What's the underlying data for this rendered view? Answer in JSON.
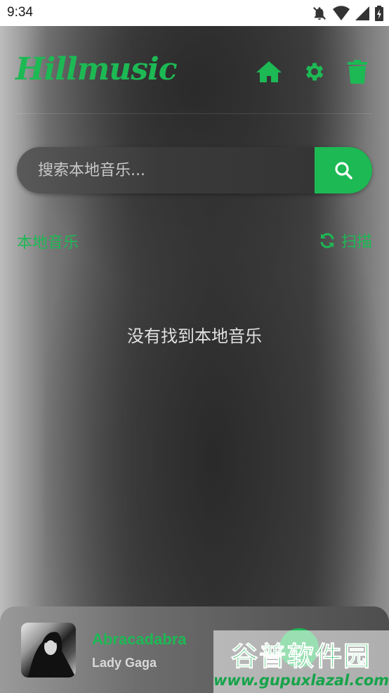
{
  "status_bar": {
    "time": "9:34",
    "icons": [
      "bell-off-icon",
      "wifi-icon",
      "signal-icon",
      "battery-icon"
    ]
  },
  "header": {
    "logo": "Hillmusic",
    "icons": [
      "home-icon",
      "gear-icon",
      "trash-icon"
    ]
  },
  "search": {
    "placeholder": "搜索本地音乐...",
    "value": "",
    "button_icon": "search-icon"
  },
  "section": {
    "title": "本地音乐",
    "scan_label": "扫描",
    "scan_icon": "refresh-icon"
  },
  "empty_message": "没有找到本地音乐",
  "now_playing": {
    "title": "Abracadabra",
    "artist": "Lady Gaga"
  },
  "watermark": {
    "main": "谷普软件园",
    "sub": "www.gupuxlazal.com"
  },
  "colors": {
    "accent": "#1db954",
    "status_bar_bg": "#ffffff"
  }
}
